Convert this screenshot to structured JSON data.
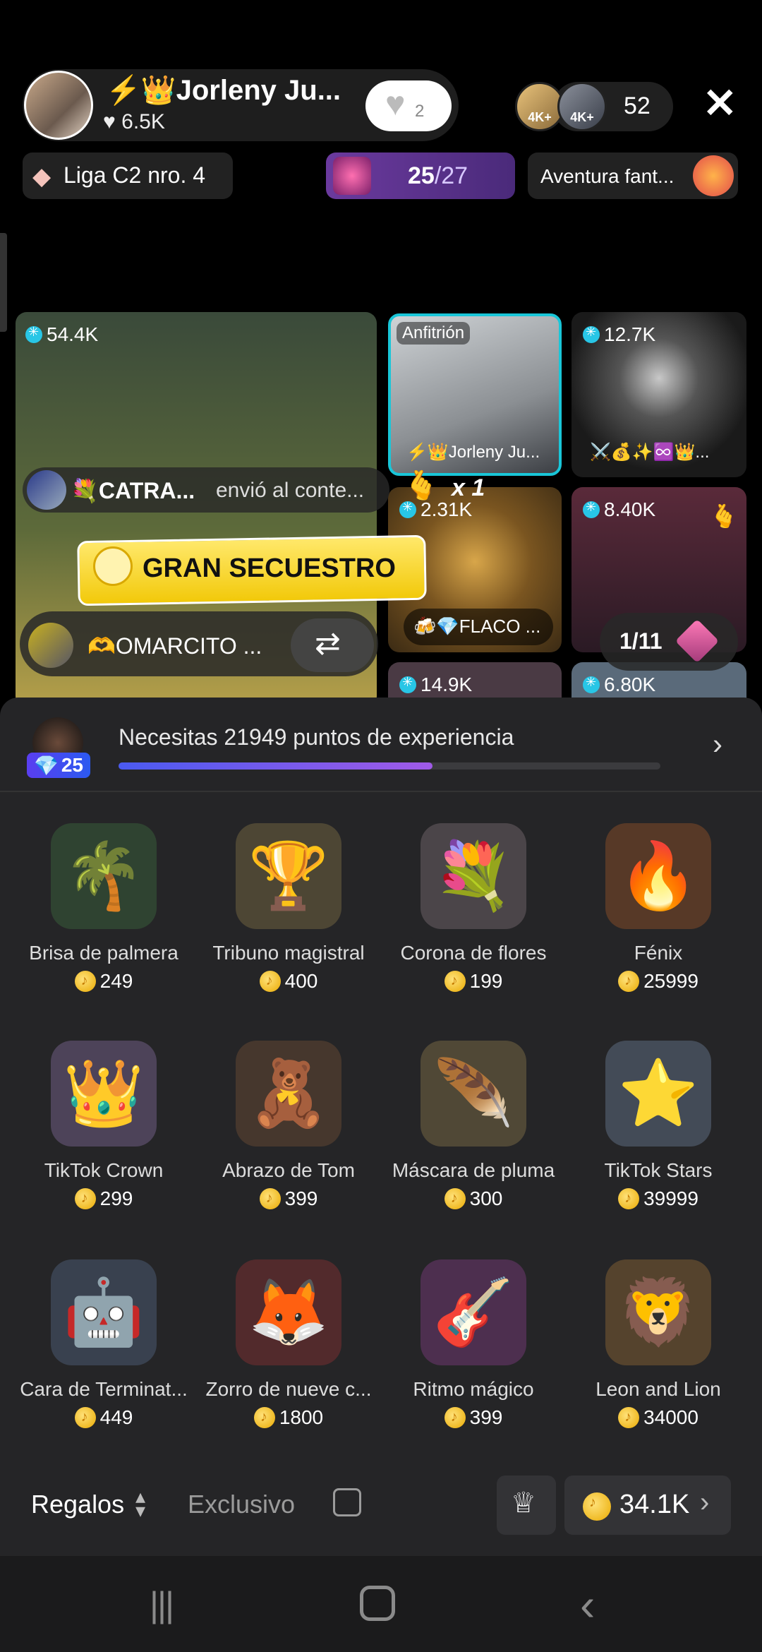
{
  "header": {
    "host_name": "⚡👑Jorleny Ju...",
    "host_likes": "6.5K",
    "follow_count": "2",
    "viewer_badges": [
      "4K+",
      "4K+"
    ],
    "viewer_count": "52"
  },
  "chips": {
    "league": "Liga C2 nro. 4",
    "rank_current": "25",
    "rank_total": "/27",
    "adventure": "Aventura fant..."
  },
  "grid": {
    "main_score": "54.4K",
    "host_label": "Anfitrión",
    "host_name": "⚡👑Jorleny Ju...",
    "t3_score": "12.7K",
    "t3_names": "⚔️💰✨♾️👑...",
    "t4_score": "2.31K",
    "t4_name": "🍻💎FLACO ...",
    "t5_score": "8.40K",
    "t6_score": "14.9K",
    "t7_score": "6.80K",
    "combo": "x 1",
    "page_indicator": "1/11"
  },
  "overlays": {
    "sender_name": "💐CATRA...",
    "sender_action": "envió al conte...",
    "banner": "GRAN SECUESTRO",
    "user_name": "🫶OMARCITO ..."
  },
  "level": {
    "badge": "25",
    "xp_text": "Necesitas 21949 puntos de experiencia",
    "progress": 0.58
  },
  "gifts": [
    {
      "name": "Brisa de palmera",
      "price": "249",
      "icon": "🌴"
    },
    {
      "name": "Tribuno magistral",
      "price": "400",
      "icon": "🏆"
    },
    {
      "name": "Corona de flores",
      "price": "199",
      "icon": "💐"
    },
    {
      "name": "Fénix",
      "price": "25999",
      "icon": "🔥"
    },
    {
      "name": "TikTok Crown",
      "price": "299",
      "icon": "👑"
    },
    {
      "name": "Abrazo de Tom",
      "price": "399",
      "icon": "🧸"
    },
    {
      "name": "Máscara de pluma",
      "price": "300",
      "icon": "🪶"
    },
    {
      "name": "TikTok Stars",
      "price": "39999",
      "icon": "⭐"
    },
    {
      "name": "Cara de Terminat...",
      "price": "449",
      "icon": "🤖"
    },
    {
      "name": "Zorro de nueve c...",
      "price": "1800",
      "icon": "🦊"
    },
    {
      "name": "Ritmo mágico",
      "price": "399",
      "icon": "🎸"
    },
    {
      "name": "Leon and Lion",
      "price": "34000",
      "icon": "🦁"
    }
  ],
  "footer": {
    "tab_gifts": "Regalos",
    "tab_exclusive": "Exclusivo",
    "balance": "34.1K"
  }
}
